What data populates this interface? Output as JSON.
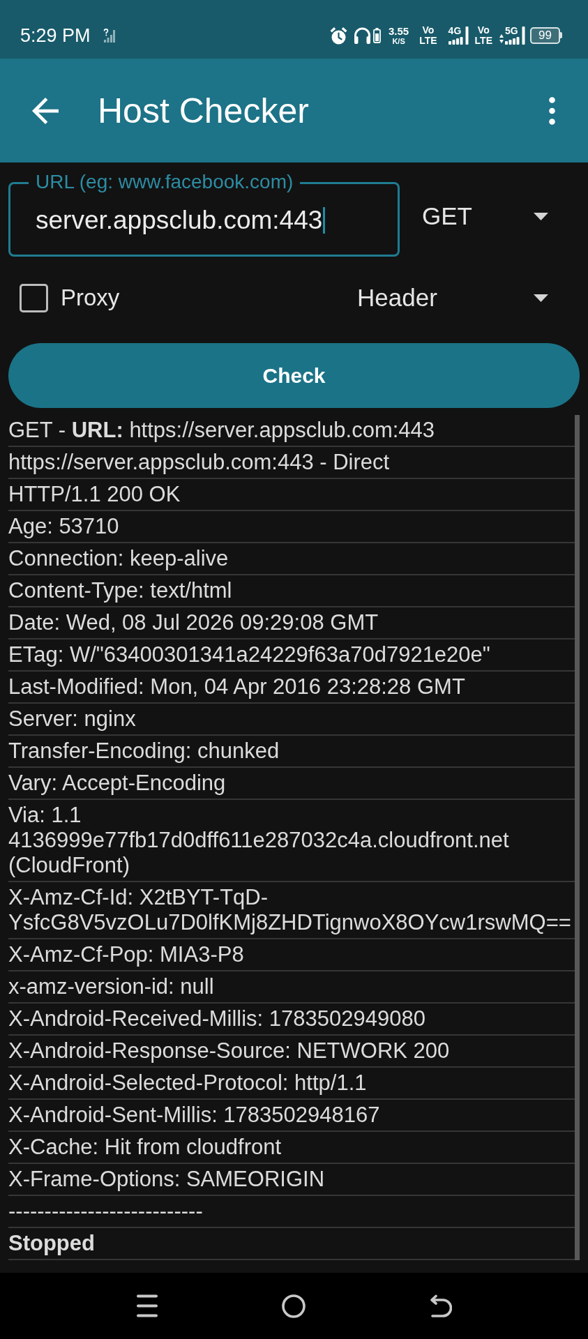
{
  "status_bar": {
    "time": "5:29 PM",
    "net_speed": {
      "value": "3.55",
      "unit": "K/S"
    },
    "sims": [
      {
        "volte_top": "Vo",
        "volte_bottom": "LTE",
        "network": "4G",
        "data_active": false
      },
      {
        "volte_top": "Vo",
        "volte_bottom": "LTE",
        "network": "5G",
        "data_active": true
      }
    ],
    "battery": "99"
  },
  "app_bar": {
    "title": "Host Checker"
  },
  "form": {
    "url": {
      "label": "URL (eg: www.facebook.com)",
      "value": "server.appsclub.com:443"
    },
    "method": "GET",
    "proxy": {
      "label": "Proxy",
      "checked": false
    },
    "mode": "Header",
    "check_button": "Check"
  },
  "output": [
    {
      "text": "GET - **URL:** https://server.appsclub.com:443",
      "bold": false
    },
    {
      "text": "https://server.appsclub.com:443 - Direct",
      "bold": false
    },
    {
      "text": "HTTP/1.1 200 OK",
      "bold": false
    },
    {
      "text": "Age: 53710",
      "bold": false
    },
    {
      "text": "Connection: keep-alive",
      "bold": false
    },
    {
      "text": "Content-Type: text/html",
      "bold": false
    },
    {
      "text": "Date: Wed, 08 Jul 2026 09:29:08 GMT",
      "bold": false
    },
    {
      "text": "ETag: W/\"63400301341a24229f63a70d7921e20e\"",
      "bold": false
    },
    {
      "text": "Last-Modified: Mon, 04 Apr 2016 23:28:28 GMT",
      "bold": false
    },
    {
      "text": "Server: nginx",
      "bold": false
    },
    {
      "text": "Transfer-Encoding: chunked",
      "bold": false
    },
    {
      "text": "Vary: Accept-Encoding",
      "bold": false
    },
    {
      "text": "Via: 1.1 4136999e77fb17d0dff611e287032c4a.cloudfront.net (CloudFront)",
      "bold": false
    },
    {
      "text": "X-Amz-Cf-Id: X2tBYT-TqD-YsfcG8V5vzOLu7D0lfKMj8ZHDTignwoX8OYcw1rswMQ==",
      "bold": false
    },
    {
      "text": "X-Amz-Cf-Pop: MIA3-P8",
      "bold": false
    },
    {
      "text": "x-amz-version-id: null",
      "bold": false
    },
    {
      "text": "X-Android-Received-Millis: 1783502949080",
      "bold": false
    },
    {
      "text": "X-Android-Response-Source: NETWORK 200",
      "bold": false
    },
    {
      "text": "X-Android-Selected-Protocol: http/1.1",
      "bold": false
    },
    {
      "text": "X-Android-Sent-Millis: 1783502948167",
      "bold": false
    },
    {
      "text": "X-Cache: Hit from cloudfront",
      "bold": false
    },
    {
      "text": "X-Frame-Options: SAMEORIGIN",
      "bold": false
    },
    {
      "text": "---------------------------",
      "bold": false
    },
    {
      "text": "Stopped",
      "bold": true
    }
  ]
}
